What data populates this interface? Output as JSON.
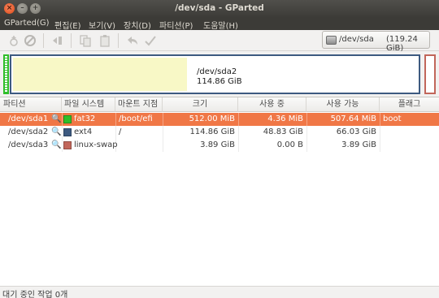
{
  "window": {
    "title": "/dev/sda - GParted"
  },
  "menu": {
    "items": [
      "GParted(G)",
      "편집(E)",
      "보기(V)",
      "장치(D)",
      "파티션(P)",
      "도움말(H)"
    ]
  },
  "toolbar": {
    "icons": [
      "new-partition-icon",
      "delete-icon",
      "resize-move-icon",
      "copy-icon",
      "paste-icon",
      "undo-icon",
      "apply-icon"
    ],
    "device": {
      "name": "/dev/sda",
      "size": "(119.24 GiB)"
    }
  },
  "partition_map": {
    "main_partition": {
      "name": "/dev/sda2",
      "size": "114.86 GiB"
    },
    "colors": {
      "efi": "#2fbe29",
      "ext4": "#3d5a80",
      "swap": "#c1665a",
      "used": "#f8f8c6"
    }
  },
  "table": {
    "headers": [
      "파티션",
      "파일 시스템",
      "마운트 지점",
      "크기",
      "사용 중",
      "사용 가능",
      "플래그"
    ],
    "rows": [
      {
        "partition": "/dev/sda1",
        "filesystem": "fat32",
        "color": "#2fbe29",
        "mount": "/boot/efi",
        "size": "512.00 MiB",
        "used": "4.36 MiB",
        "available": "507.64 MiB",
        "flags": "boot",
        "selected": true
      },
      {
        "partition": "/dev/sda2",
        "filesystem": "ext4",
        "color": "#3d5a80",
        "mount": "/",
        "size": "114.86 GiB",
        "used": "48.83 GiB",
        "available": "66.03 GiB",
        "flags": "",
        "selected": false
      },
      {
        "partition": "/dev/sda3",
        "filesystem": "linux-swap",
        "color": "#c1665a",
        "mount": "",
        "size": "3.89 GiB",
        "used": "0.00 B",
        "available": "3.89 GiB",
        "flags": "",
        "selected": false
      }
    ]
  },
  "status": {
    "text": "대기 중인 작업 0개"
  }
}
